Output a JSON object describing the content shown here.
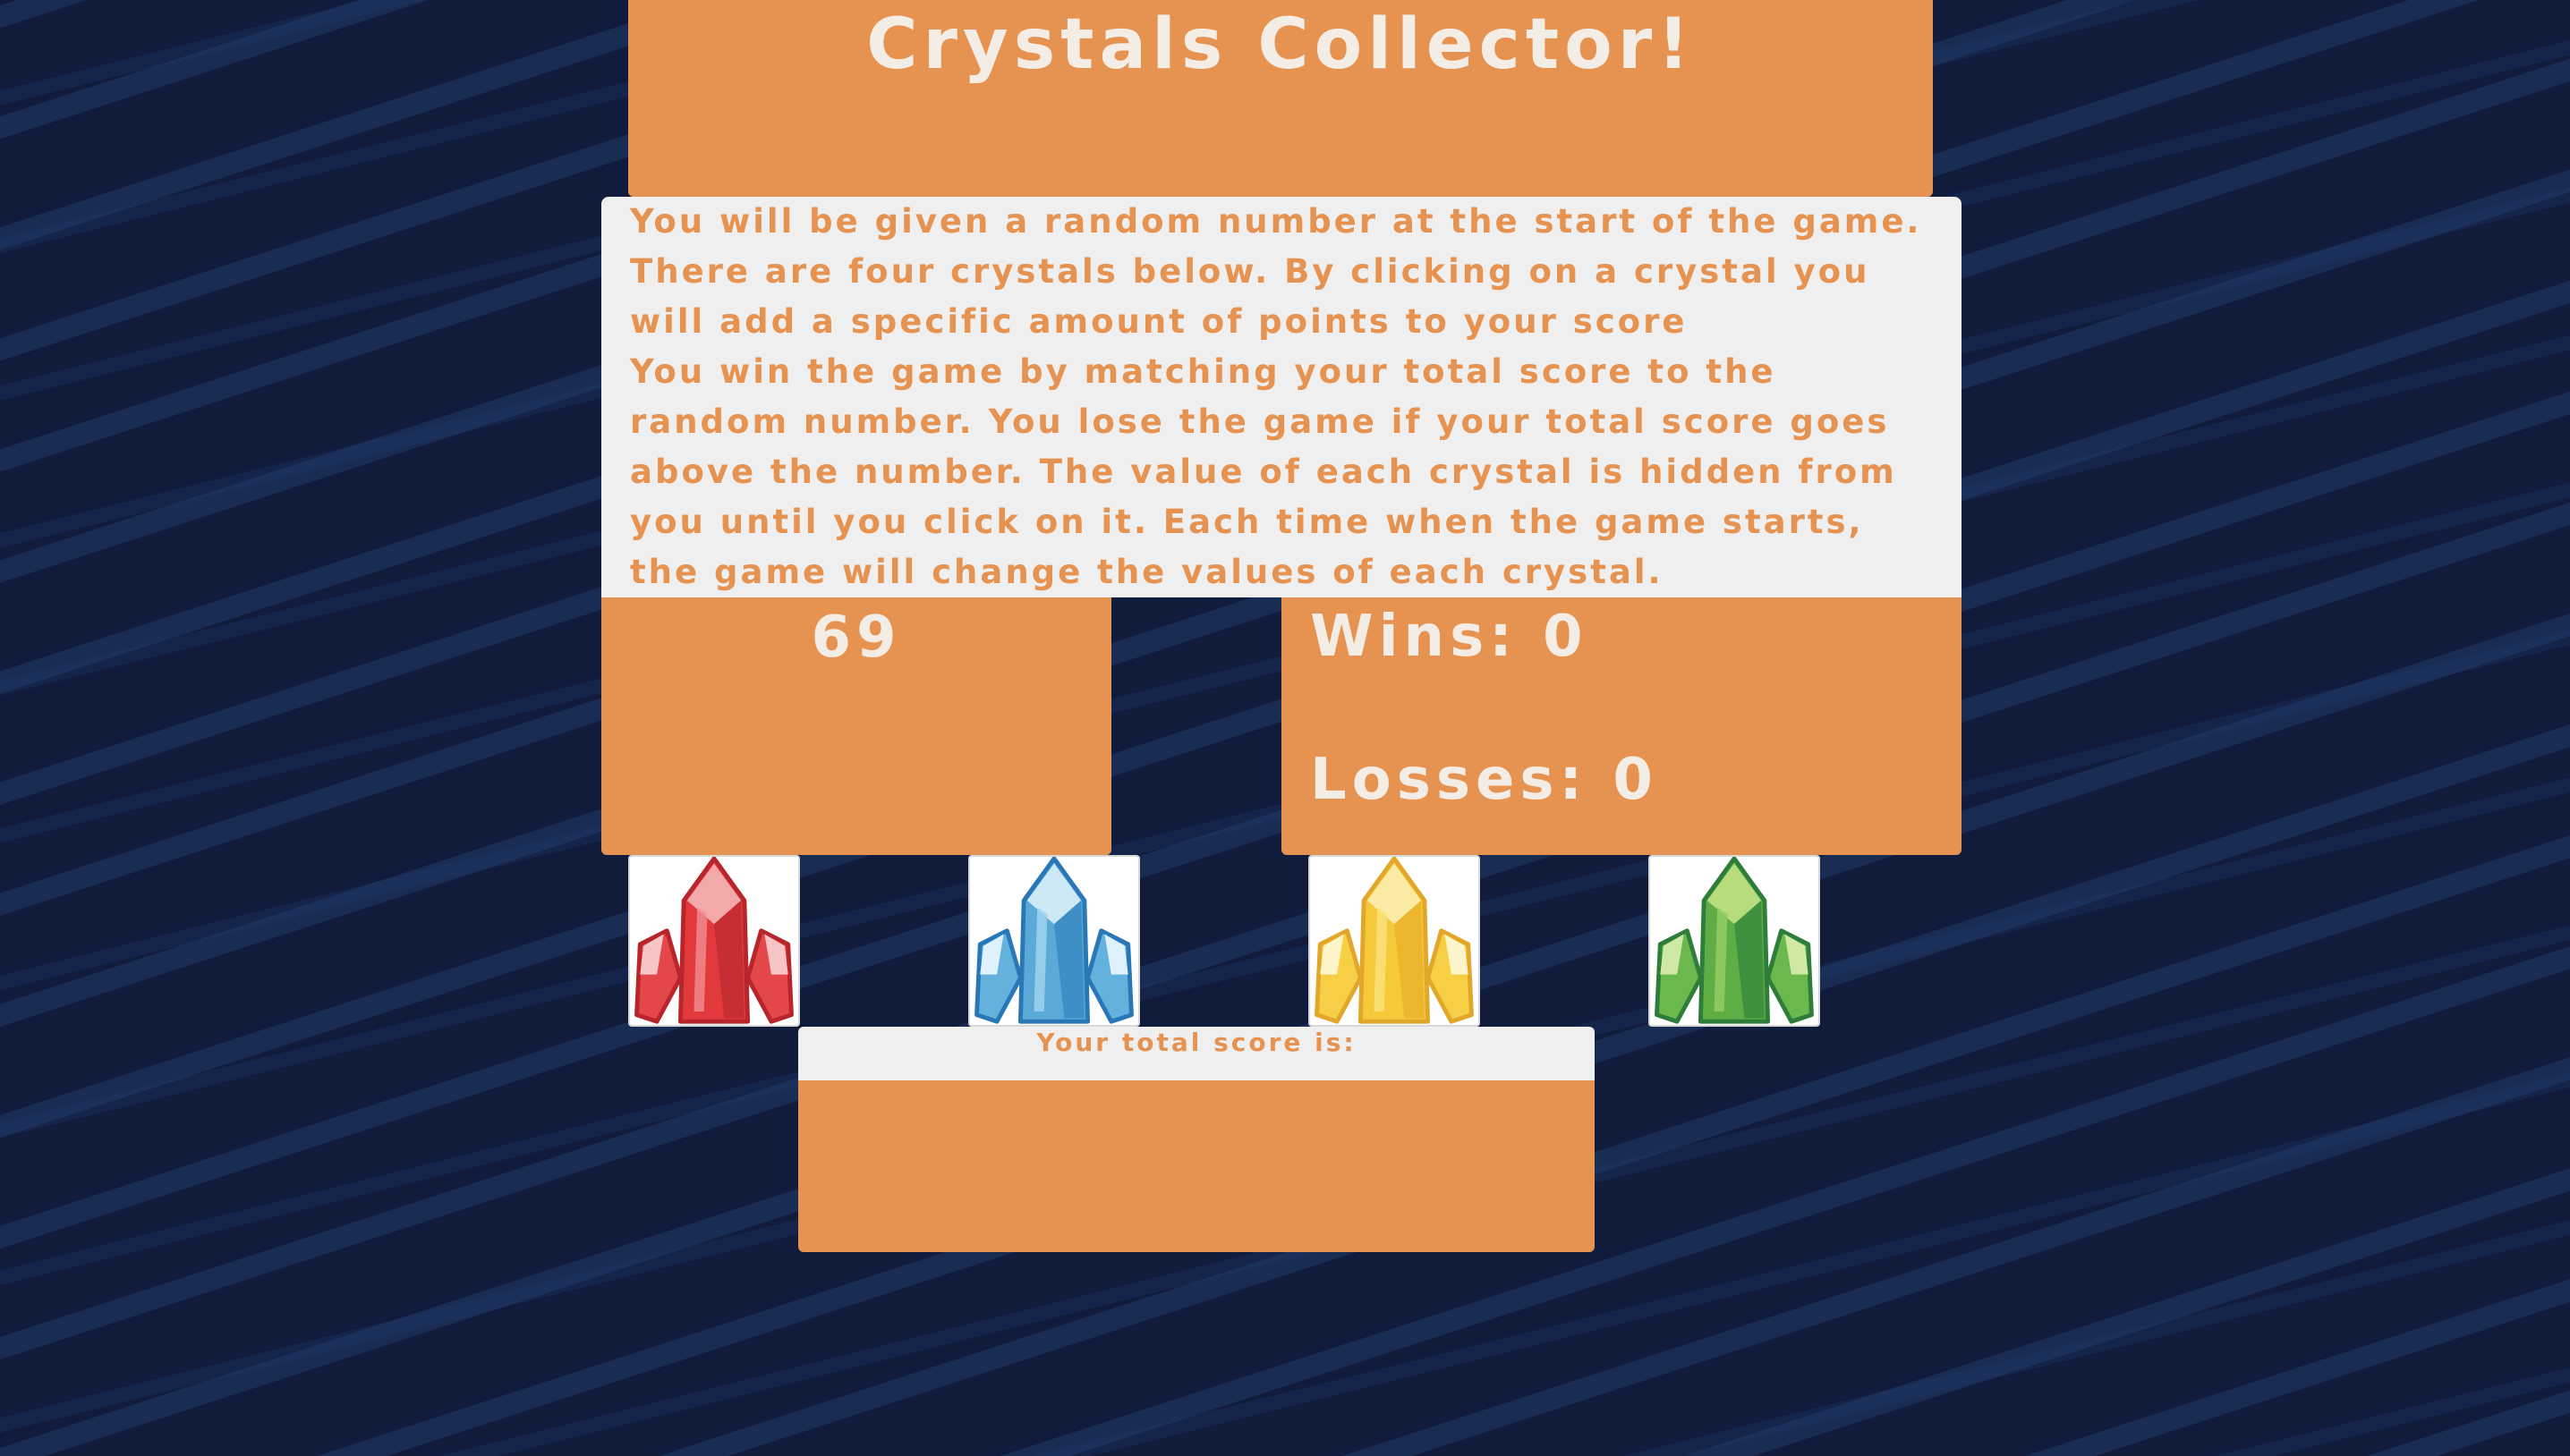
{
  "header": {
    "title": "Crystals Collector!"
  },
  "instructions": {
    "paragraph_1": "You will be given a random number at the start of the game. There are four crystals below. By clicking on a crystal you will add a specific amount of points to your score",
    "paragraph_2": "You win the game by matching your total score to the random number. You lose the game if your total score goes above the number. The value of each crystal is hidden from you until you click on it. Each time when the game starts, the game will change the values of each crystal."
  },
  "game": {
    "target_number": "69",
    "wins_text": "Wins: 0",
    "losses_text": "Losses: 0",
    "score_label": "Your total score is:",
    "score_value": ""
  },
  "crystals": [
    {
      "icon": "red-crystal-icon",
      "color": "#e03a3a"
    },
    {
      "icon": "blue-crystal-icon",
      "color": "#5aa9d6"
    },
    {
      "icon": "yellow-crystal-icon",
      "color": "#f5c93a"
    },
    {
      "icon": "green-crystal-icon",
      "color": "#5fae45"
    }
  ],
  "colors": {
    "background": "#111c3c",
    "panel_orange": "#e69352",
    "panel_grey": "#efefef",
    "panel_text_light": "#f3ede6"
  }
}
